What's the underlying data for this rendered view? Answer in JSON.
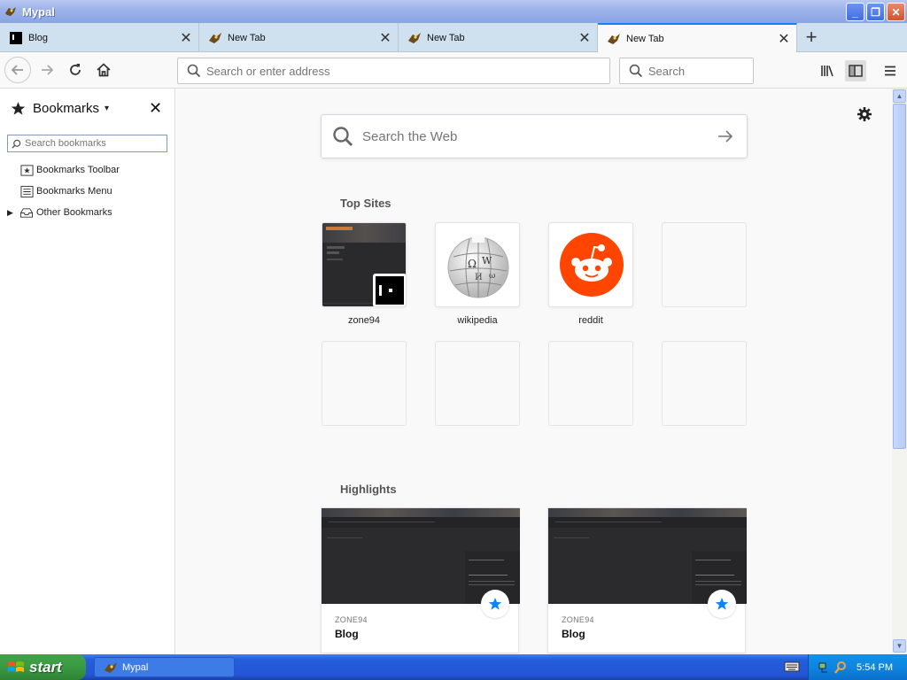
{
  "window": {
    "title": "Mypal",
    "buttons": {
      "minimize": "_",
      "maximize": "❐",
      "close": "✕"
    }
  },
  "tabs": [
    {
      "title": "Blog",
      "icon": "zone94-favicon",
      "active": false
    },
    {
      "title": "New Tab",
      "icon": "mypal-favicon",
      "active": false
    },
    {
      "title": "New Tab",
      "icon": "mypal-favicon",
      "active": false
    },
    {
      "title": "New Tab",
      "icon": "mypal-favicon",
      "active": true
    }
  ],
  "toolbar": {
    "new_tab": "+",
    "address_placeholder": "Search or enter address",
    "search_placeholder": "Search"
  },
  "sidebar": {
    "title": "Bookmarks",
    "close": "✕",
    "search_placeholder": "Search bookmarks",
    "items": [
      {
        "label": "Bookmarks Toolbar",
        "icon": "bookmarks-toolbar-icon"
      },
      {
        "label": "Bookmarks Menu",
        "icon": "bookmarks-menu-icon"
      },
      {
        "label": "Other Bookmarks",
        "icon": "other-bookmarks-icon",
        "expandable": true
      }
    ]
  },
  "newtab": {
    "search_placeholder": "Search the Web",
    "top_sites_title": "Top Sites",
    "top_sites": [
      {
        "label": "zone94"
      },
      {
        "label": "wikipedia"
      },
      {
        "label": "reddit"
      },
      {
        "label": ""
      },
      {
        "label": ""
      },
      {
        "label": ""
      },
      {
        "label": ""
      },
      {
        "label": ""
      }
    ],
    "highlights_title": "Highlights",
    "highlights": [
      {
        "site": "ZONE94",
        "title": "Blog"
      },
      {
        "site": "ZONE94",
        "title": "Blog"
      }
    ]
  },
  "taskbar": {
    "start_label": "start",
    "task_label": "Mypal",
    "clock": "5:54 PM"
  },
  "colors": {
    "accent": "#0a84ff",
    "reddit": "#ff4500",
    "star": "#0a84ff"
  }
}
